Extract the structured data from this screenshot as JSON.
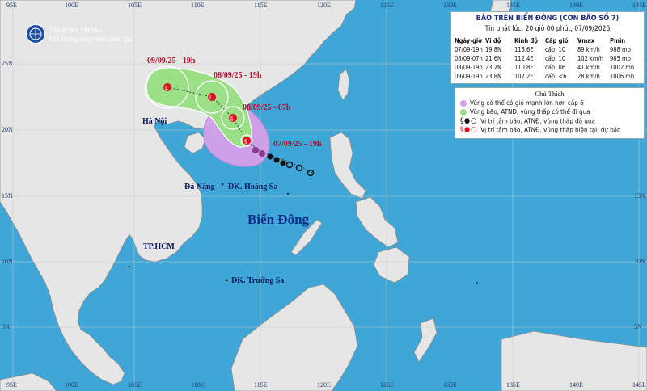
{
  "header": {
    "org_line1": "Trung tâm Dự báo",
    "org_line2": "Khí tượng thủy văn quốc gia"
  },
  "info": {
    "title": "BÃO TRÊN BIỂN ĐÔNG (CƠN BÃO SỐ 7)",
    "issued": "Tin phát lúc: 20 giờ 00 phút, 07/09/2025",
    "columns": [
      "Ngày-giờ",
      "Vĩ độ",
      "Kinh độ",
      "Cấp gió",
      "Vmax",
      "Pmin"
    ],
    "rows": [
      [
        "07/09-19h",
        "19.8N",
        "113.6E",
        "cấp: 10",
        "89 km/h",
        "988 mb"
      ],
      [
        "08/09-07h",
        "21.6N",
        "112.4E",
        "cấp: 10",
        "102 km/h",
        "985 mb"
      ],
      [
        "08/09-19h",
        "23.2N",
        "110.8E",
        "cấp: 06",
        "41 km/h",
        "1002 mb"
      ],
      [
        "09/09-19h",
        "23.8N",
        "107.2E",
        "cấp: <6",
        "28 km/h",
        "1006 mb"
      ]
    ]
  },
  "legend": {
    "title": "Chú Thích",
    "items": [
      "Vùng có thể có gió mạnh lớn hơn cấp 6",
      "Vùng bão, ATNĐ, vùng thấp có thể đi qua",
      "Vị trí tâm bão, ATNĐ, vùng thấp đã qua",
      "Vị trí tâm bão, ATNĐ, vùng thấp hiện tại, dự báo"
    ],
    "colors": {
      "wind_area": "#d5a0e8",
      "track_area": "#9be086",
      "past": "#111111",
      "forecast": "#e01020"
    }
  },
  "map_labels": {
    "hanoi": "Hà Nội",
    "danang": "Đà Nẵng",
    "hoangsa": "ĐK. Hoàng Sa",
    "hcm": "TP.HCM",
    "truongsa": "ĐK. Trường Sa",
    "sea": "Biển Đông",
    "t1": "09/09/25 - 19h",
    "t2": "08/09/25 - 19h",
    "t3": "08/09/25 - 07h",
    "t4": "07/09/25 - 19h"
  },
  "grid": {
    "lon_top": [
      "95E",
      "100E",
      "105E",
      "110E",
      "115E",
      "120E",
      "125E",
      "130E",
      "135E",
      "140E",
      "145E"
    ],
    "lon_bottom": [
      "95E",
      "100E",
      "105E",
      "110E",
      "115E",
      "120E",
      "125E",
      "130E",
      "135E",
      "140E",
      "145E"
    ],
    "lat_left": [
      "25N",
      "20N",
      "15N",
      "10N",
      "5N"
    ],
    "lat_right": [
      "25N",
      "20N",
      "15N",
      "10N",
      "5N"
    ]
  }
}
